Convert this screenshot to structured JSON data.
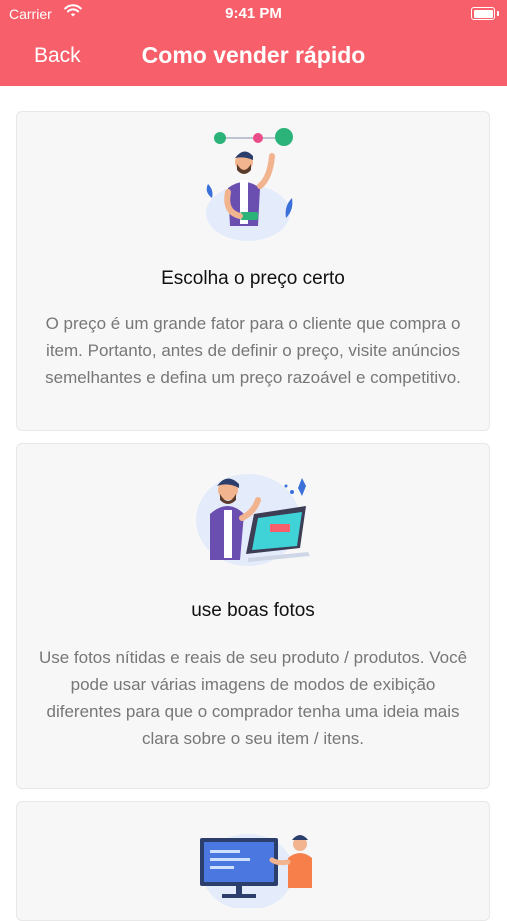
{
  "status_bar": {
    "carrier": "Carrier",
    "time": "9:41 PM"
  },
  "navbar": {
    "back_label": "Back",
    "title": "Como vender rápido"
  },
  "colors": {
    "accent": "#f7606a",
    "card_bg": "#f7f7f7",
    "body_text": "#777777"
  },
  "cards": [
    {
      "illustration": "man-setting-price-illustration",
      "title": "Escolha o preço certo",
      "body": "O preço é um grande fator para o cliente que compra o item. Portanto, antes de definir o preço, visite anúncios semelhantes e defina um preço razoável e competitivo."
    },
    {
      "illustration": "man-at-computer-illustration",
      "title": "use boas fotos",
      "body": "Use fotos nítidas e reais de seu produto / produtos. Você pode usar várias imagens de modos de exibição diferentes para que o comprador tenha uma ideia mais clara sobre o seu item / itens."
    },
    {
      "illustration": "presenter-screen-illustration",
      "title": "",
      "body": ""
    }
  ]
}
